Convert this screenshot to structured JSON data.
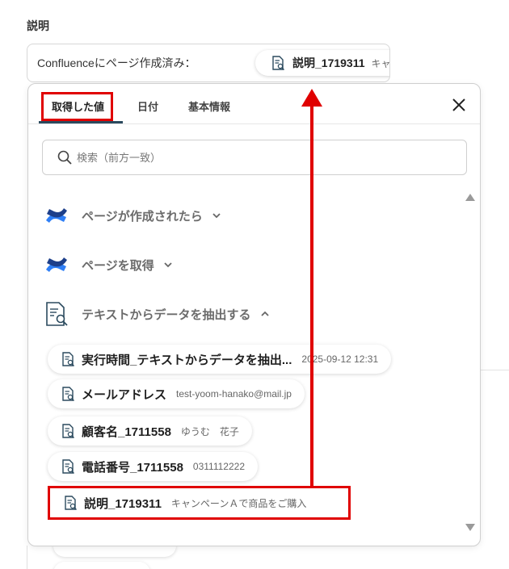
{
  "field": {
    "label": "説明",
    "prefix": "Confluenceにページ作成済み：",
    "chip_name": "説明_1719311",
    "chip_value": "キャンペーンＡで商品をご購入"
  },
  "panel": {
    "tabs": [
      {
        "label": "取得した値",
        "active": true
      },
      {
        "label": "日付",
        "active": false
      },
      {
        "label": "基本情報",
        "active": false
      }
    ],
    "search_placeholder": "検索（前方一致）",
    "groups": [
      {
        "label": "ページが作成されたら",
        "icon": "confluence-logo-icon",
        "expanded": false
      },
      {
        "label": "ページを取得",
        "icon": "confluence-logo-icon",
        "expanded": false
      },
      {
        "label": "テキストからデータを抽出する",
        "icon": "document-search-icon",
        "expanded": true
      }
    ],
    "items": [
      {
        "name": "実行時間_テキストからデータを抽出...",
        "value": "2025-09-12 12:31"
      },
      {
        "name": "メールアドレス",
        "value": "test-yoom-hanako@mail.jp"
      },
      {
        "name": "顧客名_1711558",
        "value": "ゆうむ　花子"
      },
      {
        "name": "電話番号_1711558",
        "value": "0311112222"
      },
      {
        "name": "説明_1719311",
        "value": "キャンペーンＡで商品をご購入",
        "highlighted": true
      }
    ]
  },
  "colors": {
    "highlight": "#e00000",
    "confluence_dark": "#1d3f8a",
    "confluence_light": "#2f7ff6",
    "doc_icon": "#2b4a5e"
  }
}
